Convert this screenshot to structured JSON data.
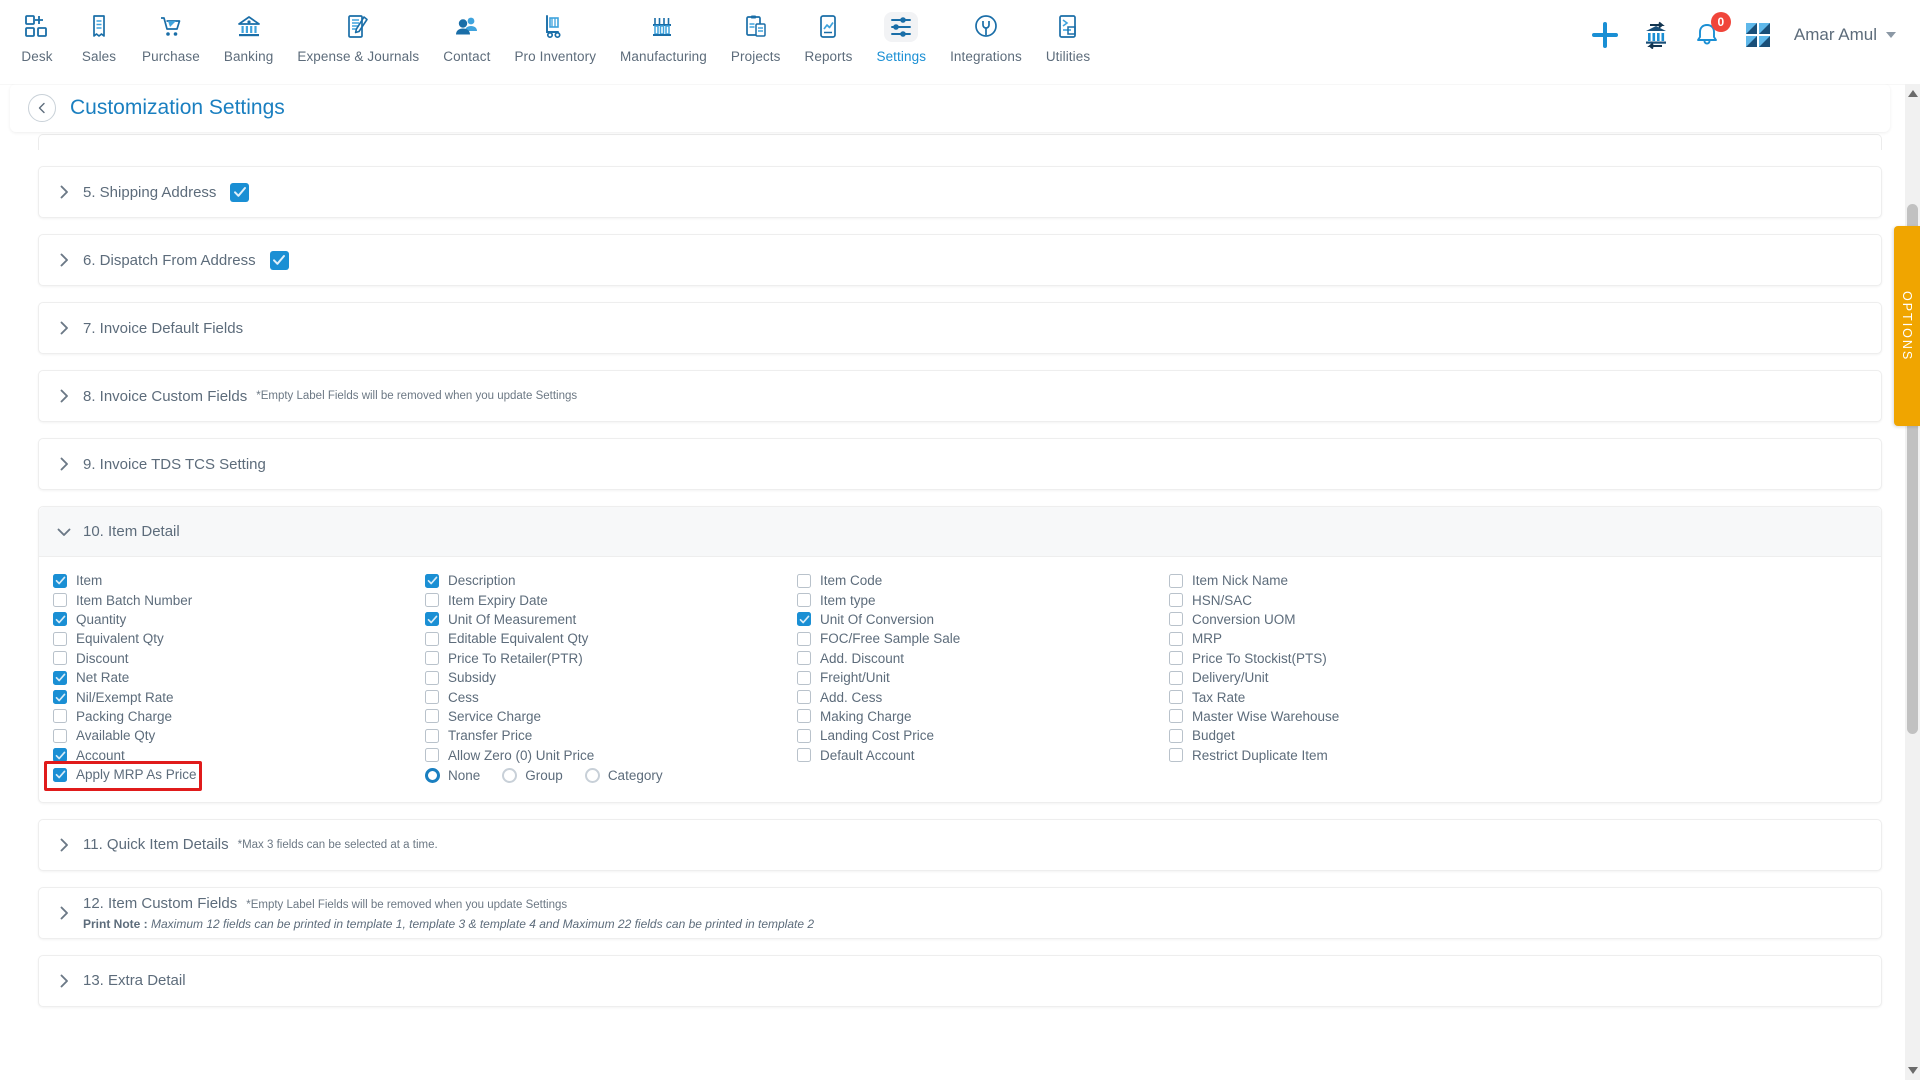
{
  "topnav": {
    "items": [
      {
        "label": "Desk",
        "icon": "desk-icon",
        "active": false
      },
      {
        "label": "Sales",
        "icon": "sales-receipt-icon",
        "active": false
      },
      {
        "label": "Purchase",
        "icon": "cart-icon",
        "active": false
      },
      {
        "label": "Banking",
        "icon": "bank-icon",
        "active": false
      },
      {
        "label": "Expense & Journals",
        "icon": "journal-icon",
        "active": false
      },
      {
        "label": "Contact",
        "icon": "contacts-icon",
        "active": false
      },
      {
        "label": "Pro Inventory",
        "icon": "handtruck-icon",
        "active": false
      },
      {
        "label": "Manufacturing",
        "icon": "factory-icon",
        "active": false
      },
      {
        "label": "Projects",
        "icon": "clipboard-icon",
        "active": false
      },
      {
        "label": "Reports",
        "icon": "report-chart-icon",
        "active": false
      },
      {
        "label": "Settings",
        "icon": "sliders-icon",
        "active": true
      },
      {
        "label": "Integrations",
        "icon": "plug-icon",
        "active": false
      },
      {
        "label": "Utilities",
        "icon": "utilities-icon",
        "active": false
      }
    ],
    "actions": {
      "add": "add-plus-icon",
      "bank_transfer": "bank-transfer-icon",
      "notifications": "bell-icon",
      "notification_count": "0",
      "apps": "grid-apps-icon"
    },
    "user": {
      "name": "Amar Amul",
      "caret": "chevron-down-icon"
    }
  },
  "page": {
    "back": "back-chevron-icon",
    "title": "Customization Settings"
  },
  "options_tab": {
    "label": "OPTIONS"
  },
  "sections": [
    {
      "id": "s5",
      "title": "5. Shipping Address",
      "note": "",
      "expanded": false,
      "checked": true
    },
    {
      "id": "s6",
      "title": "6. Dispatch From Address",
      "note": "",
      "expanded": false,
      "checked": true
    },
    {
      "id": "s7",
      "title": "7. Invoice Default Fields",
      "note": "",
      "expanded": false,
      "checked": false
    },
    {
      "id": "s8",
      "title": "8. Invoice Custom Fields",
      "note": "*Empty Label Fields will be removed when you update Settings",
      "expanded": false,
      "checked": false
    },
    {
      "id": "s9",
      "title": "9. Invoice TDS TCS Setting",
      "note": "",
      "expanded": false,
      "checked": false
    },
    {
      "id": "s10",
      "title": "10. Item Detail",
      "note": "",
      "expanded": true,
      "checked": false
    },
    {
      "id": "s11",
      "title": "11. Quick Item Details",
      "note": "*Max 3 fields can be selected at a time.",
      "expanded": false,
      "checked": false
    },
    {
      "id": "s12",
      "title": "12. Item Custom Fields",
      "note": "*Empty Label Fields will be removed when you update Settings",
      "print_note_label": "Print Note :",
      "print_note_text": " Maximum 12 fields can be printed in template 1, template 3 & template 4 and Maximum 22 fields can be printed in template 2",
      "expanded": false,
      "checked": false
    },
    {
      "id": "s13",
      "title": "13. Extra Detail",
      "note": "",
      "expanded": false,
      "checked": false
    }
  ],
  "item_detail": {
    "columns": [
      [
        {
          "label": "Item",
          "checked": true,
          "highlight": false
        },
        {
          "label": "Item Batch Number",
          "checked": false,
          "highlight": false
        },
        {
          "label": "Quantity",
          "checked": true,
          "highlight": false
        },
        {
          "label": "Equivalent Qty",
          "checked": false,
          "highlight": false
        },
        {
          "label": "Discount",
          "checked": false,
          "highlight": false
        },
        {
          "label": "Net Rate",
          "checked": true,
          "highlight": false
        },
        {
          "label": "Nil/Exempt Rate",
          "checked": true,
          "highlight": false
        },
        {
          "label": "Packing Charge",
          "checked": false,
          "highlight": false
        },
        {
          "label": "Available Qty",
          "checked": false,
          "highlight": false
        },
        {
          "label": "Account",
          "checked": true,
          "highlight": false
        },
        {
          "label": "Apply MRP As Price",
          "checked": true,
          "highlight": true
        }
      ],
      [
        {
          "label": "Description",
          "checked": true,
          "highlight": false
        },
        {
          "label": "Item Expiry Date",
          "checked": false,
          "highlight": false
        },
        {
          "label": "Unit Of Measurement",
          "checked": true,
          "highlight": false
        },
        {
          "label": "Editable Equivalent Qty",
          "checked": false,
          "highlight": false
        },
        {
          "label": "Price To Retailer(PTR)",
          "checked": false,
          "highlight": false
        },
        {
          "label": "Subsidy",
          "checked": false,
          "highlight": false
        },
        {
          "label": "Cess",
          "checked": false,
          "highlight": false
        },
        {
          "label": "Service Charge",
          "checked": false,
          "highlight": false
        },
        {
          "label": "Transfer Price",
          "checked": false,
          "highlight": false
        },
        {
          "label": "Allow Zero (0) Unit Price",
          "checked": false,
          "highlight": false
        }
      ],
      [
        {
          "label": "Item Code",
          "checked": false,
          "highlight": false
        },
        {
          "label": "Item type",
          "checked": false,
          "highlight": false
        },
        {
          "label": "Unit Of Conversion",
          "checked": true,
          "highlight": false
        },
        {
          "label": "FOC/Free Sample Sale",
          "checked": false,
          "highlight": false
        },
        {
          "label": "Add. Discount",
          "checked": false,
          "highlight": false
        },
        {
          "label": "Freight/Unit",
          "checked": false,
          "highlight": false
        },
        {
          "label": "Add. Cess",
          "checked": false,
          "highlight": false
        },
        {
          "label": "Making Charge",
          "checked": false,
          "highlight": false
        },
        {
          "label": "Landing Cost Price",
          "checked": false,
          "highlight": false
        },
        {
          "label": "Default Account",
          "checked": false,
          "highlight": false
        }
      ],
      [
        {
          "label": "Item Nick Name",
          "checked": false,
          "highlight": false
        },
        {
          "label": "HSN/SAC",
          "checked": false,
          "highlight": false
        },
        {
          "label": "Conversion UOM",
          "checked": false,
          "highlight": false
        },
        {
          "label": "MRP",
          "checked": false,
          "highlight": false
        },
        {
          "label": "Price To Stockist(PTS)",
          "checked": false,
          "highlight": false
        },
        {
          "label": "Delivery/Unit",
          "checked": false,
          "highlight": false
        },
        {
          "label": "Tax Rate",
          "checked": false,
          "highlight": false
        },
        {
          "label": "Master Wise Warehouse",
          "checked": false,
          "highlight": false
        },
        {
          "label": "Budget",
          "checked": false,
          "highlight": false
        },
        {
          "label": "Restrict Duplicate Item",
          "checked": false,
          "highlight": false
        }
      ]
    ],
    "radios": [
      {
        "label": "None",
        "selected": true
      },
      {
        "label": "Group",
        "selected": false
      },
      {
        "label": "Category",
        "selected": false
      }
    ]
  }
}
